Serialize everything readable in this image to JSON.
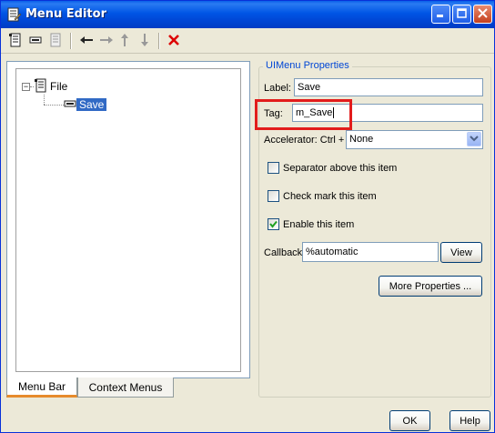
{
  "window": {
    "title": "Menu Editor"
  },
  "titlebar": {
    "icons": [
      "minimize-icon",
      "maximize-icon",
      "close-icon"
    ]
  },
  "toolbar": {
    "icons": [
      "new-menu-icon",
      "new-menu-item-icon",
      "new-context-menu-icon",
      "move-backward-icon",
      "move-forward-icon",
      "move-up-icon",
      "move-down-icon",
      "delete-icon"
    ]
  },
  "tree": {
    "items": [
      {
        "label": "File",
        "expander": "⊟"
      },
      {
        "label": "Save"
      }
    ]
  },
  "tabs": [
    {
      "label": "Menu Bar"
    },
    {
      "label": "Context Menus"
    }
  ],
  "properties": {
    "group_title": "UIMenu Properties",
    "label_caption": "Label:",
    "label_value": "Save",
    "tag_caption": "Tag:",
    "tag_value": "m_Save",
    "accelerator_caption": "Accelerator: Ctrl +",
    "accelerator_value": "None",
    "separator_label": "Separator above this item",
    "separator_checked": false,
    "checkmark_label": "Check mark this item",
    "checkmark_checked": false,
    "enable_label": "Enable this item",
    "enable_checked": true,
    "callback_caption": "Callback:",
    "callback_value": "%automatic",
    "view_label": "View",
    "more_label": "More Properties ..."
  },
  "footer": {
    "ok_label": "OK",
    "help_label": "Help"
  },
  "colors": {
    "titlebar": "#0055e5",
    "highlight": "#e21c1c",
    "selection": "#316ac5",
    "group_title": "#0046d5"
  }
}
